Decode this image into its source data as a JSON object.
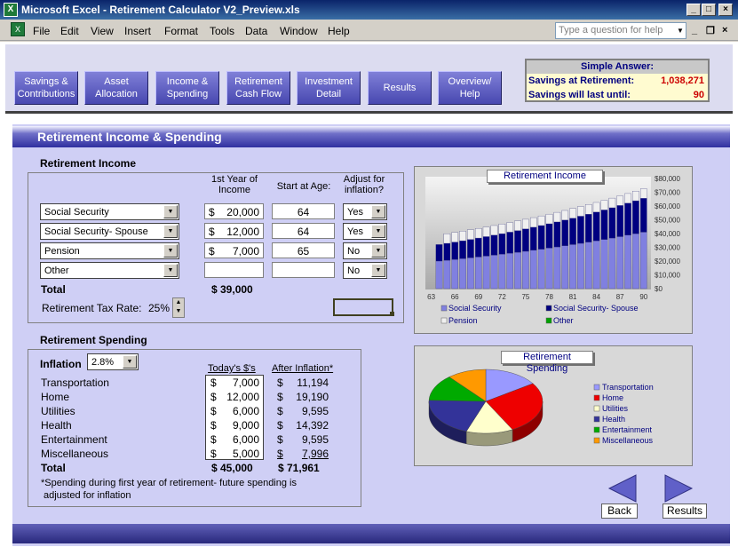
{
  "window": {
    "title": "Microsoft Excel - Retirement Calculator V2_Preview.xls",
    "app_icon": "excel-icon"
  },
  "menu": {
    "items": [
      "File",
      "Edit",
      "View",
      "Insert",
      "Format",
      "Tools",
      "Data",
      "Window",
      "Help"
    ],
    "help_placeholder": "Type a question for help"
  },
  "nav": {
    "buttons": [
      {
        "line1": "Savings &",
        "line2": "Contributions"
      },
      {
        "line1": "Asset",
        "line2": "Allocation"
      },
      {
        "line1": "Income &",
        "line2": "Spending"
      },
      {
        "line1": "Retirement",
        "line2": "Cash Flow"
      },
      {
        "line1": "Investment",
        "line2": "Detail"
      },
      {
        "line1": "Results",
        "line2": ""
      },
      {
        "line1": "Overview/",
        "line2": "Help"
      }
    ]
  },
  "simple_answer": {
    "title": "Simple Answer:",
    "savings_label": "Savings at Retirement:",
    "savings_value": "1,038,271",
    "last_label": "Savings will last until:",
    "last_value": "90"
  },
  "page_title": "Retirement Income & Spending",
  "income": {
    "heading": "Retirement Income",
    "col_first_year_1": "1st Year of",
    "col_first_year_2": "Income",
    "col_start_age": "Start at Age:",
    "col_adjust_1": "Adjust for",
    "col_adjust_2": "inflation?",
    "rows": [
      {
        "source": "Social Security",
        "cur": "$",
        "amount": "20,000",
        "age": "64",
        "adjust": "Yes"
      },
      {
        "source": "Social Security- Spouse",
        "cur": "$",
        "amount": "12,000",
        "age": "64",
        "adjust": "Yes"
      },
      {
        "source": "Pension",
        "cur": "$",
        "amount": "7,000",
        "age": "65",
        "adjust": "No"
      },
      {
        "source": "Other",
        "cur": "",
        "amount": "",
        "age": "",
        "adjust": "No"
      }
    ],
    "total_label": "Total",
    "total_value": "$  39,000",
    "tax_label": "Retirement Tax Rate:",
    "tax_value": "25%"
  },
  "spending": {
    "heading": "Retirement Spending",
    "inflation_label": "Inflation",
    "inflation_value": "2.8%",
    "col_today": "Today's $'s",
    "col_after": "After Inflation*",
    "rows": [
      {
        "name": "Transportation",
        "today": "7,000",
        "after": "11,194"
      },
      {
        "name": "Home",
        "today": "12,000",
        "after": "19,190"
      },
      {
        "name": "Utilities",
        "today": "6,000",
        "after": "9,595"
      },
      {
        "name": "Health",
        "today": "9,000",
        "after": "14,392"
      },
      {
        "name": "Entertainment",
        "today": "6,000",
        "after": "9,595"
      },
      {
        "name": "Miscellaneous",
        "today": "5,000",
        "after": "7,996"
      }
    ],
    "cur": "$",
    "total_label": "Total",
    "total_today": "$  45,000",
    "total_after": "$  71,961",
    "note_1": "*Spending during first year of retirement- future spending is",
    "note_2": "adjusted for inflation"
  },
  "chart_data": [
    {
      "type": "bar",
      "title": "Retirement Income",
      "x_tick_labels": [
        "63",
        "66",
        "69",
        "72",
        "75",
        "78",
        "81",
        "84",
        "87",
        "90"
      ],
      "y_tick_labels": [
        "$0",
        "$10,000",
        "$20,000",
        "$30,000",
        "$40,000",
        "$50,000",
        "$60,000",
        "$70,000",
        "$80,000"
      ],
      "ylim": [
        0,
        80000
      ],
      "stacked": true,
      "categories": [
        63,
        64,
        65,
        66,
        67,
        68,
        69,
        70,
        71,
        72,
        73,
        74,
        75,
        76,
        77,
        78,
        79,
        80,
        81,
        82,
        83,
        84,
        85,
        86,
        87,
        88,
        89,
        90
      ],
      "series": [
        {
          "name": "Social Security",
          "color": "#8080e0",
          "values": [
            0,
            20000,
            20560,
            21136,
            21727,
            22336,
            22961,
            23604,
            24265,
            24944,
            25643,
            26361,
            27099,
            27858,
            28638,
            29440,
            30264,
            31111,
            31982,
            32878,
            33798,
            34745,
            35718,
            36718,
            37746,
            38803,
            39889,
            41006
          ]
        },
        {
          "name": "Social Security- Spouse",
          "color": "#000080",
          "values": [
            0,
            12000,
            12336,
            12681,
            13036,
            13401,
            13777,
            14162,
            14559,
            14967,
            15386,
            15816,
            16259,
            16715,
            17183,
            17664,
            18158,
            18667,
            19189,
            19727,
            20279,
            20847,
            21431,
            22031,
            22648,
            23282,
            23934,
            24604
          ]
        },
        {
          "name": "Pension",
          "color": "#f0f0f0",
          "values": [
            0,
            0,
            7000,
            7000,
            7000,
            7000,
            7000,
            7000,
            7000,
            7000,
            7000,
            7000,
            7000,
            7000,
            7000,
            7000,
            7000,
            7000,
            7000,
            7000,
            7000,
            7000,
            7000,
            7000,
            7000,
            7000,
            7000,
            7000
          ]
        },
        {
          "name": "Other",
          "color": "#00a000",
          "values": [
            0,
            0,
            0,
            0,
            0,
            0,
            0,
            0,
            0,
            0,
            0,
            0,
            0,
            0,
            0,
            0,
            0,
            0,
            0,
            0,
            0,
            0,
            0,
            0,
            0,
            0,
            0,
            0
          ]
        }
      ]
    },
    {
      "type": "pie",
      "title": "Retirement Spending",
      "categories": [
        "Transportation",
        "Home",
        "Utilities",
        "Health",
        "Entertainment",
        "Miscellaneous"
      ],
      "values": [
        7000,
        12000,
        6000,
        9000,
        6000,
        5000
      ],
      "colors": [
        "#9999ff",
        "#ee0000",
        "#ffffcc",
        "#333399",
        "#00aa00",
        "#ff9900"
      ]
    }
  ],
  "buttons": {
    "back": "Back",
    "results": "Results"
  }
}
